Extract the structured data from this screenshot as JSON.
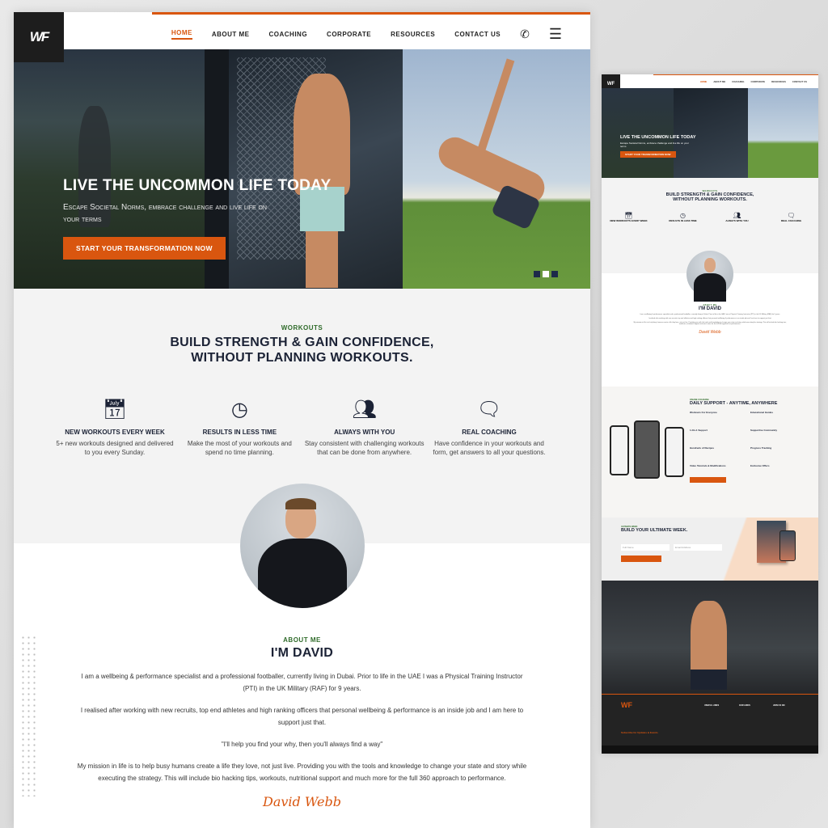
{
  "header": {
    "logo": "WF",
    "nav": [
      "HOME",
      "ABOUT ME",
      "COACHING",
      "CORPORATE",
      "RESOURCES",
      "CONTACT US"
    ],
    "active": "HOME",
    "icons": [
      "phone-icon",
      "hamburger-menu-icon"
    ]
  },
  "hero": {
    "title": "LIVE THE UNCOMMON LIFE TODAY",
    "subtitle": "Escape Societal Norms, embrace challenge and live life on your terms",
    "cta": "START YOUR TRANSFORMATION NOW",
    "slides": 3,
    "active_slide": 2
  },
  "workouts": {
    "eyebrow": "WORKOUTS",
    "title_line1": "BUILD STRENGTH & GAIN CONFIDENCE,",
    "title_line2": "WITHOUT PLANNING WORKOUTS.",
    "features": [
      {
        "icon": "calendar-icon",
        "title": "NEW WORKOUTS EVERY WEEK",
        "desc": "5+ new workouts designed and delivered to you every Sunday."
      },
      {
        "icon": "clock-icon",
        "title": "RESULTS IN LESS TIME",
        "desc": "Make the most of your workouts and spend no time planning."
      },
      {
        "icon": "people-icon",
        "title": "ALWAYS WITH YOU",
        "desc": "Stay consistent with challenging workouts that can be done from anywhere."
      },
      {
        "icon": "chat-icon",
        "title": "REAL COACHING",
        "desc": "Have confidence in your workouts and form, get answers to all your questions."
      }
    ]
  },
  "about": {
    "eyebrow": "ABOUT ME",
    "title": "I'M DAVID",
    "p1": "I am a wellbeing & performance specialist and a professional footballer, currently living in Dubai. Prior to life in the UAE I was a Physical Training Instructor (PTI) in the UK Military (RAF) for 9 years.",
    "p2": "I realised after working with new recruits, top end athletes and high ranking officers that personal wellbeing & performance is an inside job and I am here to support just that.",
    "quote": "\"I'll help you find your why, then you'll always find a way\"",
    "p3": "My mission in life is to help busy humans create a life they love, not just live. Providing you with the tools and knowledge to change your state and story while executing the strategy. This will include bio hacking tips, workouts, nutritional support and much more for the full 360 approach to performance.",
    "signature": "David Webb"
  },
  "mini": {
    "coaching": {
      "eyebrow": "ONLINE COACHING",
      "title": "DAILY SUPPORT - ANYTIME, ANYWHERE",
      "items": [
        "Workouts For Everyone",
        "Educational Guides",
        "1-On-1 Support",
        "Supportive Community",
        "Hundreds of Recipes",
        "Progress Tracking",
        "Video Tutorials & Modifications",
        "Exclusive Offers"
      ]
    },
    "week": {
      "eyebrow": "ULTIMATE WEEK",
      "title": "BUILD YOUR ULTIMATE WEEK.",
      "name_placeholder": "Full Name",
      "email_placeholder": "Email Address"
    },
    "footer": {
      "col1": "USEFUL LINKS",
      "col2": "OUR LINKS",
      "col3": "JOIN US ON",
      "subscribe": "Subscribe for Updates & Events"
    }
  },
  "colors": {
    "accent": "#d9560f",
    "navy": "#1b2235",
    "green": "#2f6b2a",
    "dark": "#1d1d1d"
  }
}
